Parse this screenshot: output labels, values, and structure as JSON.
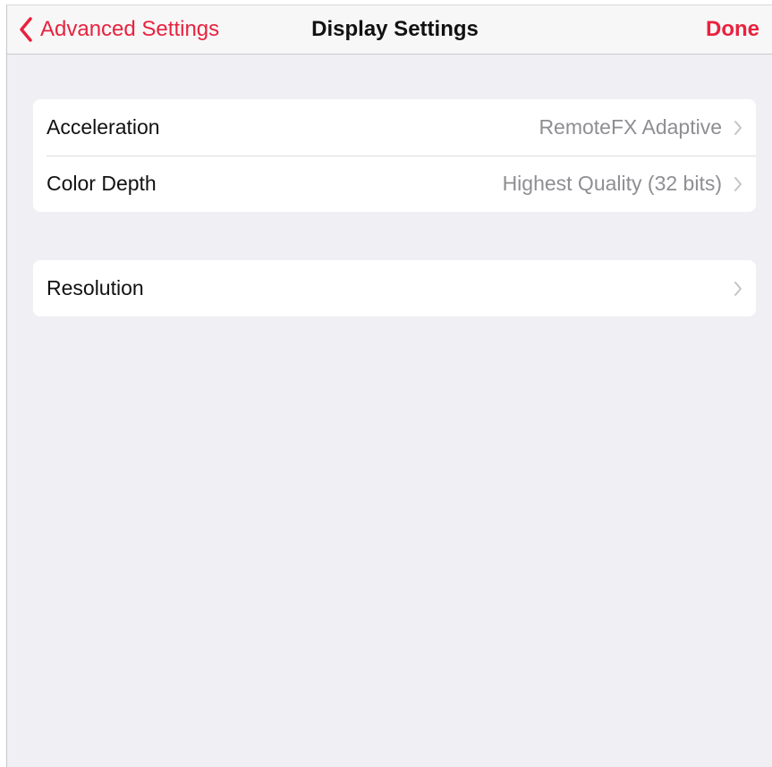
{
  "navbar": {
    "back_label": "Advanced Settings",
    "title": "Display Settings",
    "done_label": "Done"
  },
  "groups": [
    {
      "rows": [
        {
          "label": "Acceleration",
          "value": "RemoteFX Adaptive"
        },
        {
          "label": "Color Depth",
          "value": "Highest Quality (32 bits)"
        }
      ]
    },
    {
      "rows": [
        {
          "label": "Resolution",
          "value": ""
        }
      ]
    }
  ],
  "colors": {
    "accent": "#e8223f",
    "background": "#efeff4",
    "secondary_text": "#8e8e93"
  },
  "icons": {
    "back": "chevron-left-icon",
    "disclosure": "chevron-right-icon"
  }
}
